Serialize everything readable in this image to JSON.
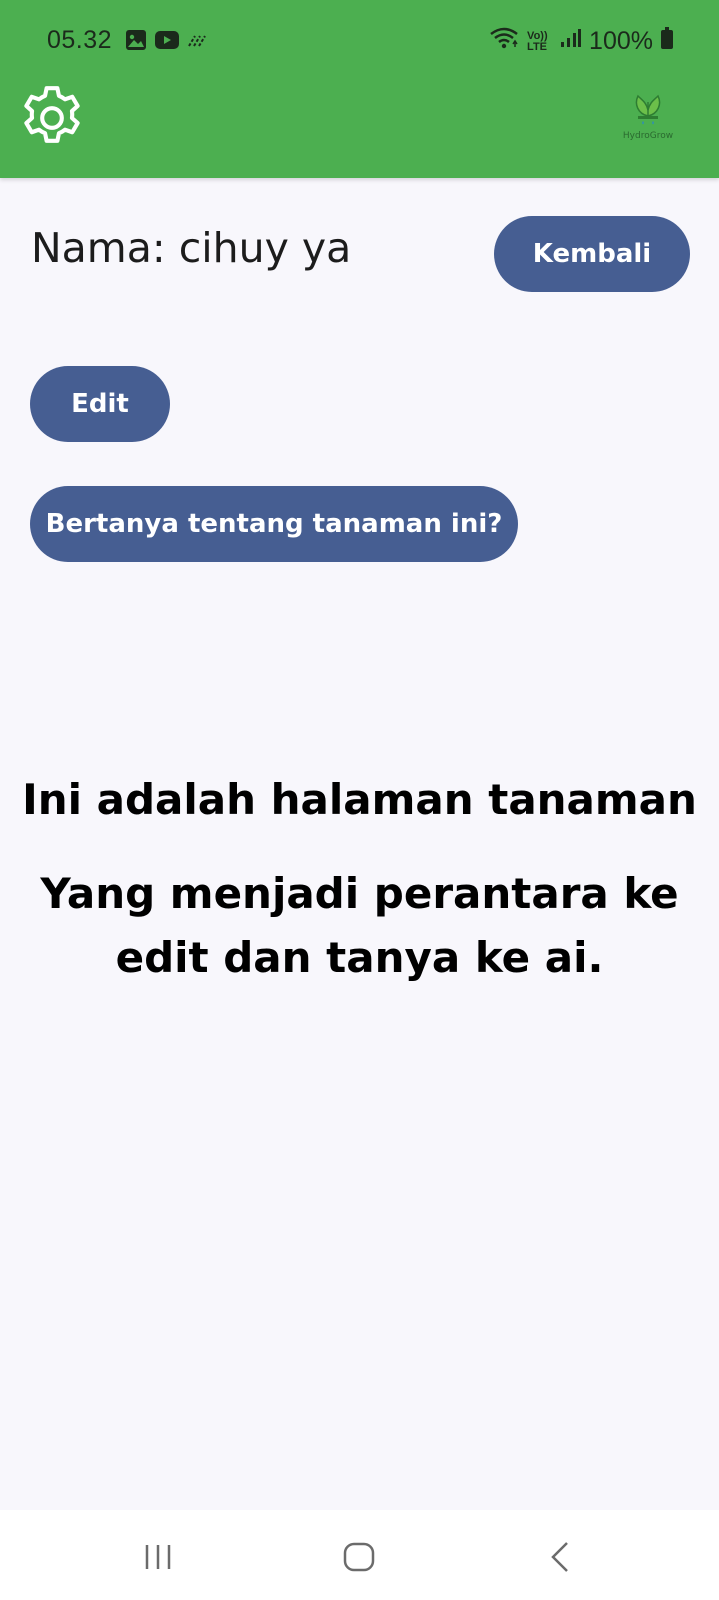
{
  "status_bar": {
    "time": "05.32",
    "battery": "100%",
    "notification_icons": [
      "gallery-icon",
      "youtube-icon",
      "sync-icon"
    ],
    "system_icons": [
      "wifi-icon",
      "volte-icon",
      "signal-icon",
      "battery-icon"
    ],
    "volte_label": "Vo)) LTE"
  },
  "header": {
    "background_color": "#4caf50",
    "settings_icon": "gear-icon",
    "logo_text": "HydroGrow"
  },
  "main": {
    "name_label": "Nama: cihuy ya",
    "back_button": "Kembali",
    "edit_button": "Edit",
    "ask_button": "Bertanya tentang tanaman ini?",
    "button_color": "#465e92",
    "headline": "Ini adalah halaman tanaman",
    "description": "Yang menjadi perantara ke edit dan tanya ke ai."
  },
  "nav_bar": {
    "recent": "recent-apps-icon",
    "home": "home-icon",
    "back": "back-icon"
  }
}
